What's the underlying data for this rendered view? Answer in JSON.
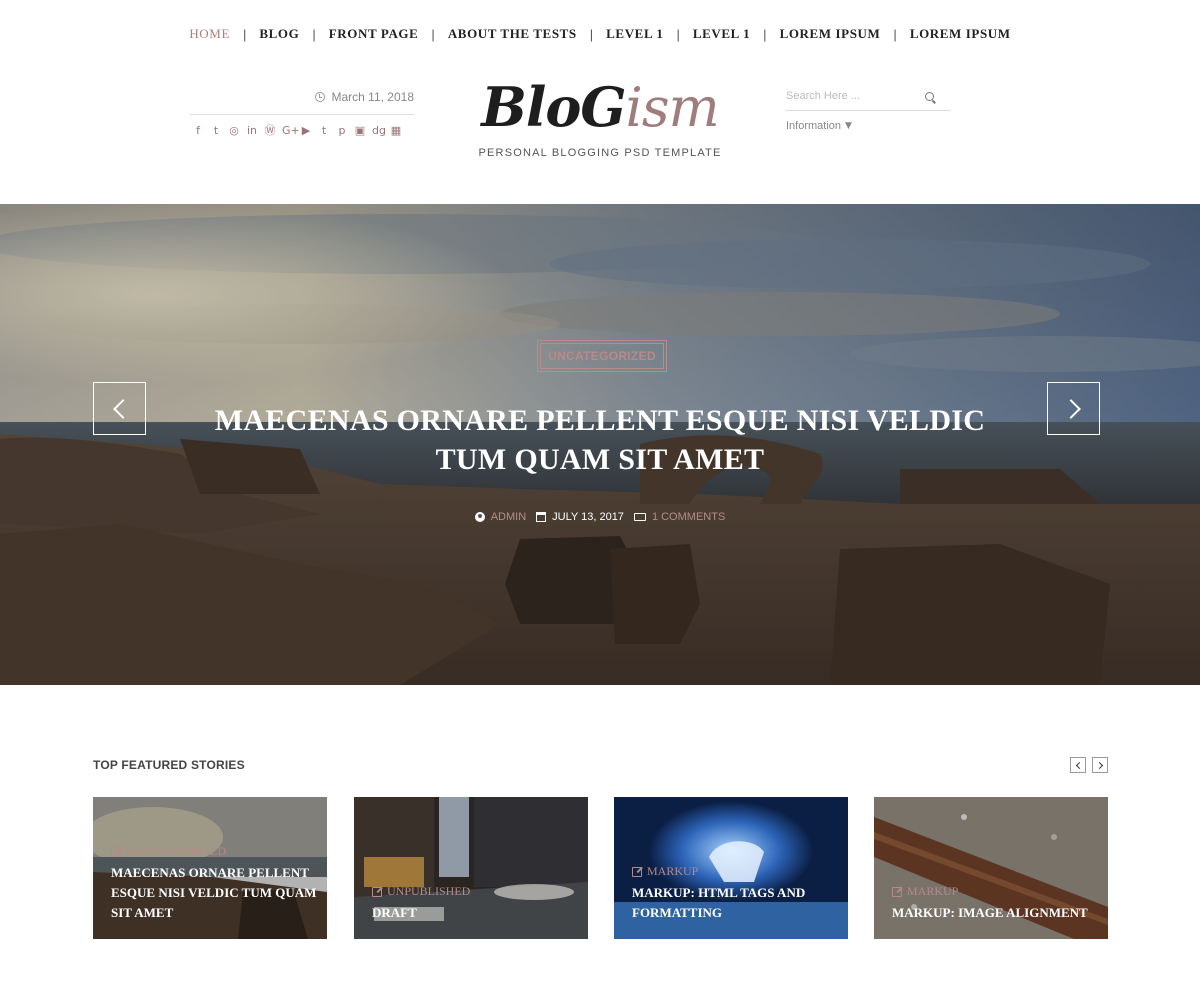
{
  "nav": {
    "items": [
      {
        "label": "HOME",
        "active": true
      },
      {
        "label": "BLOG"
      },
      {
        "label": "FRONT PAGE"
      },
      {
        "label": "ABOUT THE TESTS"
      },
      {
        "label": "LEVEL 1"
      },
      {
        "label": "LEVEL 1"
      },
      {
        "label": "LOREM IPSUM"
      },
      {
        "label": "LOREM IPSUM"
      }
    ],
    "separator": "|"
  },
  "header": {
    "date": "March 11, 2018",
    "logo_part1": "BloG",
    "logo_part2": "ism",
    "tagline": "PERSONAL BLOGGING PSD TEMPLATE",
    "search_placeholder": "Search Here ...",
    "info_dropdown": "Information",
    "social_icons": [
      "facebook-icon",
      "twitter-icon",
      "instagram-icon",
      "linkedin-icon",
      "wordpress-icon",
      "google-plus-icon",
      "youtube-icon",
      "tumblr-icon",
      "pinterest-icon",
      "briefcase-icon",
      "digg-icon",
      "table-icon"
    ]
  },
  "hero": {
    "category": "UNCATEGORIZED",
    "title": "MAECENAS ORNARE PELLENT ESQUE NISI VELDIC TUM QUAM SIT AMET",
    "author": "ADMIN",
    "date": "JULY 13, 2017",
    "comments": "1 COMMENTS"
  },
  "featured": {
    "heading": "TOP FEATURED STORIES",
    "cards": [
      {
        "category": "UNCATEGORIZED",
        "title": "MAECENAS ORNARE PELLENT ESQUE NISI VELDIC TUM QUAM SIT AMET"
      },
      {
        "category": "UNPUBLISHED",
        "title": "DRAFT"
      },
      {
        "category": "MARKUP",
        "title": "MARKUP: HTML TAGS AND FORMATTING"
      },
      {
        "category": "MARKUP",
        "title": "MARKUP: IMAGE ALIGNMENT"
      }
    ]
  },
  "colors": {
    "accent": "#a67f7f",
    "text": "#222222"
  }
}
